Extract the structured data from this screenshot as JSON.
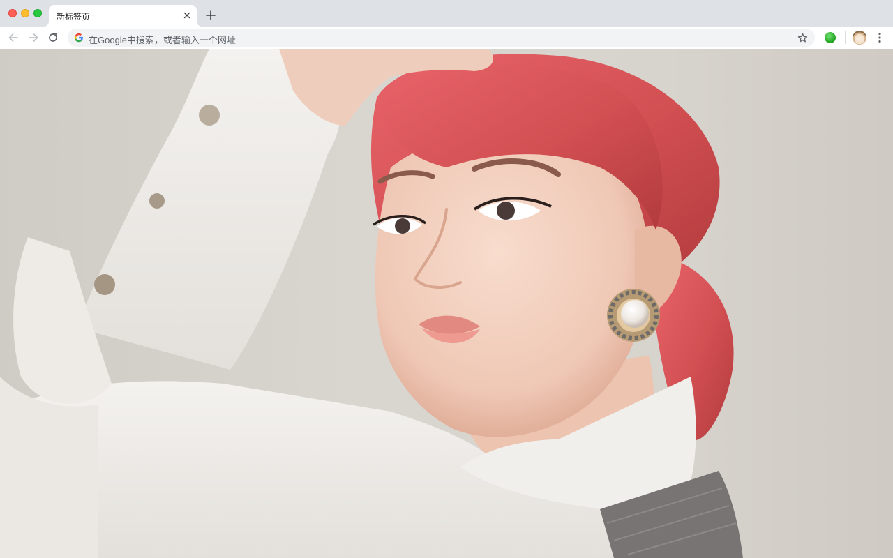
{
  "window": {
    "controls": [
      "close",
      "minimize",
      "maximize"
    ]
  },
  "tab": {
    "title": "新标签页",
    "close_icon": "close-icon"
  },
  "toolbar": {
    "back_icon": "arrow-left-icon",
    "forward_icon": "arrow-right-icon",
    "reload_icon": "reload-icon",
    "omnibox_placeholder": "在Google中搜索，或者输入一个网址",
    "bookmark_icon": "star-icon",
    "extension_icon": "green-circle-icon",
    "profile_icon": "avatar-icon",
    "menu_icon": "kebab-menu-icon"
  },
  "colors": {
    "tabstrip": "#dee1e6",
    "toolbar": "#ffffff",
    "omnibox": "#f1f3f4",
    "hair": "#d8595a",
    "background_wall": "#d6d2cc"
  }
}
